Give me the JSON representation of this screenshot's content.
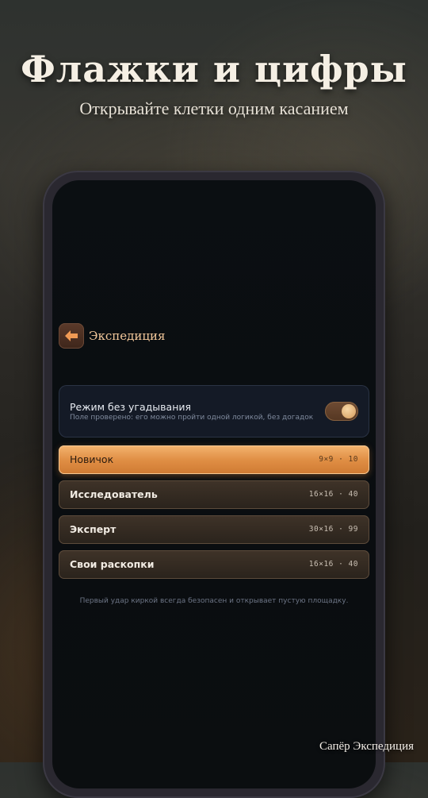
{
  "promo": {
    "headline": "Флажки и цифры",
    "subheadline": "Открывайте клетки одним касанием",
    "brand": "Сапёр Экспедиция"
  },
  "app": {
    "screen_title": "Экспедиция",
    "back_icon": "arrow-left-icon",
    "no_guess": {
      "title": "Режим без угадывания",
      "description": "Поле проверено: его можно пройти одной логикой, без догадок",
      "enabled": true
    },
    "levels": [
      {
        "name": "Новичок",
        "spec": "9×9 · 10",
        "selected": true
      },
      {
        "name": "Исследователь",
        "spec": "16×16 · 40",
        "selected": false
      },
      {
        "name": "Эксперт",
        "spec": "30×16 · 99",
        "selected": false
      },
      {
        "name": "Свои раскопки",
        "spec": "16×16 · 40",
        "selected": false
      }
    ],
    "footnote": "Первый удар киркой всегда безопасен и открывает пустую площадку."
  },
  "colors": {
    "accent": "#e39448",
    "title_accent": "#f2c79a"
  }
}
